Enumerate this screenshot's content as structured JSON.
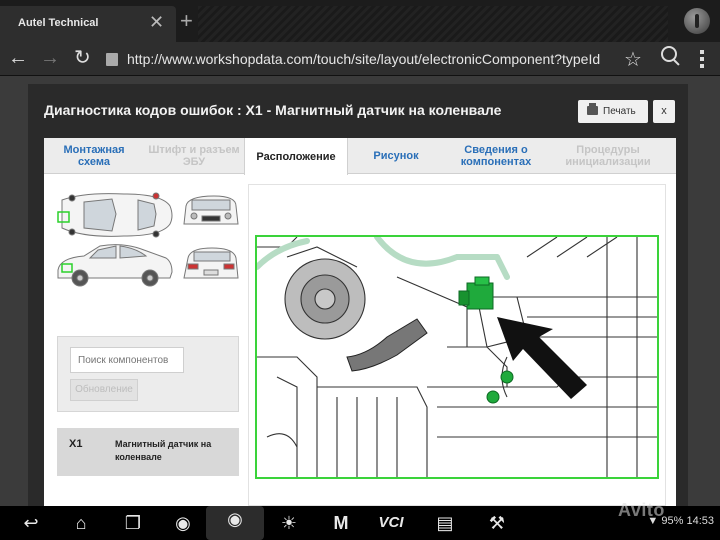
{
  "browser": {
    "tab_title": "Autel Technical",
    "tab_close": "✕",
    "new_tab": "+",
    "url": "http://www.workshopdata.com/touch/site/layout/electronicComponent?typeId"
  },
  "dialog": {
    "title": "Диагностика кодов ошибок : X1 - Магнитный датчик на коленвале",
    "print_label": "Печать",
    "close_label": "x",
    "tabs": [
      {
        "label": "Монтажная схема",
        "state": "link"
      },
      {
        "label": "Штифт и разъем ЭБУ",
        "state": "disabled"
      },
      {
        "label": "Расположение",
        "state": "active"
      },
      {
        "label": "Рисунок",
        "state": "link"
      },
      {
        "label": "Сведения о компонентах",
        "state": "link"
      },
      {
        "label": "Процедуры инициализации",
        "state": "disabled"
      }
    ],
    "search": {
      "placeholder": "Поиск компонентов",
      "refresh_label": "Обновление"
    },
    "component": {
      "code": "X1",
      "name": "Магнитный датчик на коленвале"
    }
  },
  "android": {
    "status_battery": "95%",
    "status_time": "14:53"
  },
  "watermark": "Avito",
  "colors": {
    "highlight_green": "#3ad33a",
    "component_green": "#1faa3c",
    "tab_link_blue": "#2a6fb8"
  }
}
